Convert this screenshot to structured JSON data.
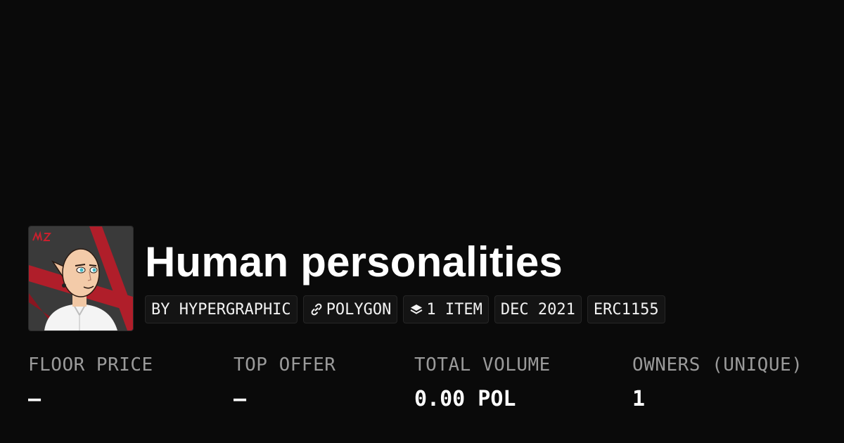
{
  "collection": {
    "title": "Human personalities",
    "avatar_alt": "collection-avatar"
  },
  "chips": {
    "creator": "BY HYPERGRAPHIC",
    "chain": "POLYGON",
    "items": "1 ITEM",
    "date": "DEC 2021",
    "standard": "ERC1155"
  },
  "icons": {
    "chain": "link-icon",
    "items": "layers-icon"
  },
  "stats": {
    "floor_price": {
      "label": "FLOOR PRICE",
      "value": "–"
    },
    "top_offer": {
      "label": "TOP OFFER",
      "value": "–"
    },
    "total_volume": {
      "label": "TOTAL VOLUME",
      "value": "0.00 POL"
    },
    "owners": {
      "label": "OWNERS (UNIQUE)",
      "value": "1"
    }
  },
  "colors": {
    "background": "#0a0a0a",
    "chip_background": "#141414",
    "label": "#9a9a9a",
    "avatar_accent": "#b01e2a"
  }
}
